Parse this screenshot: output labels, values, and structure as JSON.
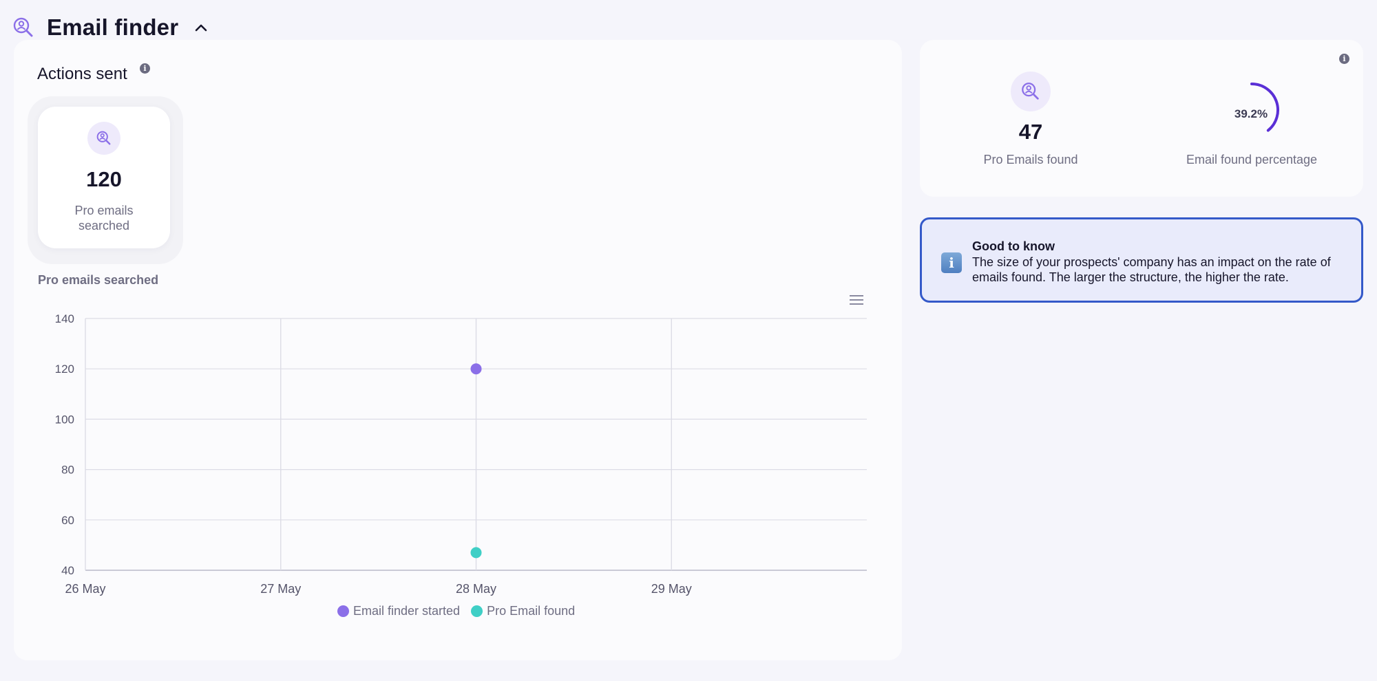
{
  "header": {
    "title": "Email finder",
    "icon": "user-search-icon",
    "collapse_icon": "chevron-up-icon"
  },
  "actions_sent": {
    "title": "Actions sent",
    "tile": {
      "value": "120",
      "label": "Pro emails searched",
      "icon": "user-search-icon"
    }
  },
  "chart_section": {
    "title": "Pro emails searched",
    "menu_icon": "hamburger-menu-icon"
  },
  "results": {
    "emails_found": {
      "value": "47",
      "label": "Pro Emails found",
      "icon": "user-search-icon"
    },
    "percentage": {
      "value": "39.2%",
      "fraction": 0.392,
      "label": "Email found percentage"
    }
  },
  "tip": {
    "title": "Good to know",
    "text": "The size of your prospects' company has an impact on the rate of emails found. The larger the structure, the higher the rate.",
    "icon": "info-icon"
  },
  "colors": {
    "accent": "#8b6fe8",
    "teal": "#3fcfc6",
    "gauge": "#5a2fd6",
    "tip_border": "#3459c9"
  },
  "chart_data": {
    "type": "scatter",
    "categories": [
      "26 May",
      "27 May",
      "28 May",
      "29 May"
    ],
    "ylim": [
      40,
      140
    ],
    "yticks": [
      140,
      120,
      100,
      80,
      60,
      40
    ],
    "grid": true,
    "legend_position": "bottom",
    "series": [
      {
        "name": "Email finder started",
        "color": "#8b6fe8",
        "points": [
          {
            "x": "28 May",
            "y": 120
          }
        ]
      },
      {
        "name": "Pro Email found",
        "color": "#3fcfc6",
        "points": [
          {
            "x": "28 May",
            "y": 47
          }
        ]
      }
    ]
  }
}
